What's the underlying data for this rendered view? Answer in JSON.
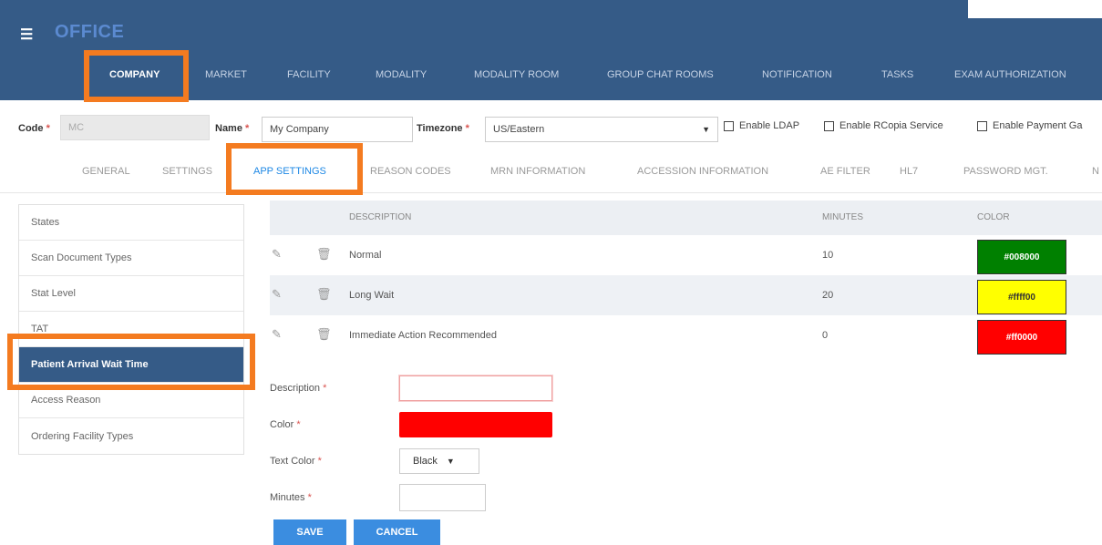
{
  "header": {
    "menu_icon": "hamburger-icon",
    "title": "OFFICE",
    "nav": [
      "COMPANY",
      "MARKET",
      "FACILITY",
      "MODALITY",
      "MODALITY ROOM",
      "GROUP CHAT ROOMS",
      "NOTIFICATION",
      "TASKS",
      "EXAM AUTHORIZATION"
    ],
    "active_nav": "COMPANY"
  },
  "form": {
    "code_label": "Code",
    "code_value": "MC",
    "name_label": "Name",
    "name_value": "My Company",
    "timezone_label": "Timezone",
    "timezone_value": "US/Eastern",
    "req_mark": "*",
    "checkboxes": [
      "Enable LDAP",
      "Enable RCopia Service",
      "Enable Payment Ga"
    ]
  },
  "subtabs": {
    "items": [
      "GENERAL",
      "SETTINGS",
      "APP SETTINGS",
      "REASON CODES",
      "MRN INFORMATION",
      "ACCESSION INFORMATION",
      "AE FILTER",
      "HL7",
      "PASSWORD MGT.",
      "N"
    ],
    "active": "APP SETTINGS"
  },
  "sidebar": {
    "items": [
      "States",
      "Scan Document Types",
      "Stat Level",
      "TAT",
      "Patient Arrival Wait Time",
      "Access Reason",
      "Ordering Facility Types"
    ],
    "active": "Patient Arrival Wait Time"
  },
  "table": {
    "columns": [
      "DESCRIPTION",
      "MINUTES",
      "COLOR"
    ],
    "edit_icon": "pencil-icon",
    "delete_icon": "trash-icon",
    "rows": [
      {
        "description": "Normal",
        "minutes": "10",
        "color": "#008000",
        "bg": "#008000",
        "fg": "#ffffff"
      },
      {
        "description": "Long Wait",
        "minutes": "20",
        "color": "#ffff00",
        "bg": "#ffff00",
        "fg": "#333333"
      },
      {
        "description": "Immediate Action Recommended",
        "minutes": "0",
        "color": "#ff0000",
        "bg": "#ff0000",
        "fg": "#ffffff"
      }
    ]
  },
  "editor": {
    "description_label": "Description",
    "color_label": "Color",
    "color_value": "#ff0000",
    "text_color_label": "Text Color",
    "text_color_value": "Black",
    "minutes_label": "Minutes",
    "save_label": "SAVE",
    "cancel_label": "CANCEL",
    "req_mark": "*"
  },
  "colors": {
    "header_bg": "#355b87",
    "highlight": "#f47b20",
    "accent": "#1e88e5"
  }
}
